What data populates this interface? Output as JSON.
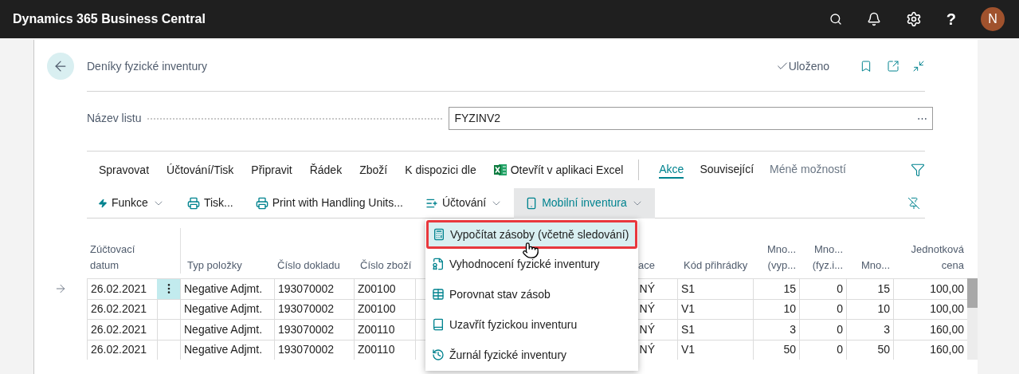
{
  "top_bar": {
    "title": "Dynamics 365 Business Central",
    "help_label": "?",
    "avatar_initial": "N"
  },
  "page": {
    "title": "Deníky fyzické inventury",
    "save_status": "Uloženo"
  },
  "field": {
    "label": "Název listu",
    "value": "FYZINV2",
    "more_label": "⋯"
  },
  "menu_tabs": [
    {
      "label": "Spravovat",
      "kind": "plain"
    },
    {
      "label": "Účtování/Tisk",
      "kind": "plain"
    },
    {
      "label": "Připravit",
      "kind": "plain"
    },
    {
      "label": "Řádek",
      "kind": "plain"
    },
    {
      "label": "Zboží",
      "kind": "plain"
    },
    {
      "label": "K dispozici dle",
      "kind": "plain"
    },
    {
      "label": "Otevřít v aplikaci Excel",
      "kind": "excel"
    }
  ],
  "view_tabs": [
    {
      "label": "Akce",
      "selected": true
    },
    {
      "label": "Související",
      "selected": false
    },
    {
      "label": "Méně možností",
      "selected": false
    }
  ],
  "actions": [
    {
      "label": "Funkce",
      "kind": "lightning",
      "dropdown": true,
      "expanded": false
    },
    {
      "label": "Tisk...",
      "kind": "printer",
      "dropdown": false,
      "expanded": false
    },
    {
      "label": "Print with Handling Units...",
      "kind": "printer",
      "dropdown": false,
      "expanded": false
    },
    {
      "label": "Účtování",
      "kind": "post",
      "dropdown": true,
      "expanded": false
    },
    {
      "label": "Mobilní inventura",
      "kind": "mobile",
      "dropdown": true,
      "expanded": true
    }
  ],
  "dropdown_menu": {
    "items": [
      {
        "label": "Vypočítat zásoby (včetně sledování)",
        "selected": true
      },
      {
        "label": "Vyhodnocení fyzické inventury",
        "selected": false
      },
      {
        "label": "Porovnat stav zásob",
        "selected": false
      },
      {
        "label": "Uzavřít fyzickou inventuru",
        "selected": false
      },
      {
        "label": "Žurnál fyzické inventury",
        "selected": false
      }
    ]
  },
  "table": {
    "columns": [
      "Zúčtovací datum",
      "Typ položky",
      "Číslo dokladu",
      "Číslo zboží",
      "ace",
      "Kód přihrádky",
      "Mno... (vyp...",
      "Mno... (fyz.i...",
      "Mno...",
      "Jednotková cena"
    ],
    "rows": [
      {
        "selected": true,
        "cells": [
          "26.02.2021",
          "Negative Adjmt.",
          "193070002",
          "Z00100",
          "NÝ",
          "S1",
          "15",
          "0",
          "15",
          "100,00"
        ]
      },
      {
        "selected": false,
        "cells": [
          "26.02.2021",
          "Negative Adjmt.",
          "193070002",
          "Z00100",
          "NÝ",
          "V1",
          "10",
          "0",
          "10",
          "100,00"
        ]
      },
      {
        "selected": false,
        "cells": [
          "26.02.2021",
          "Negative Adjmt.",
          "193070002",
          "Z00110",
          "NÝ",
          "S1",
          "3",
          "0",
          "3",
          "160,00"
        ]
      },
      {
        "selected": false,
        "cells": [
          "26.02.2021",
          "Negative Adjmt.",
          "193070002",
          "Z00110",
          "NÝ",
          "V1",
          "50",
          "0",
          "50",
          "160,00"
        ]
      }
    ]
  }
}
